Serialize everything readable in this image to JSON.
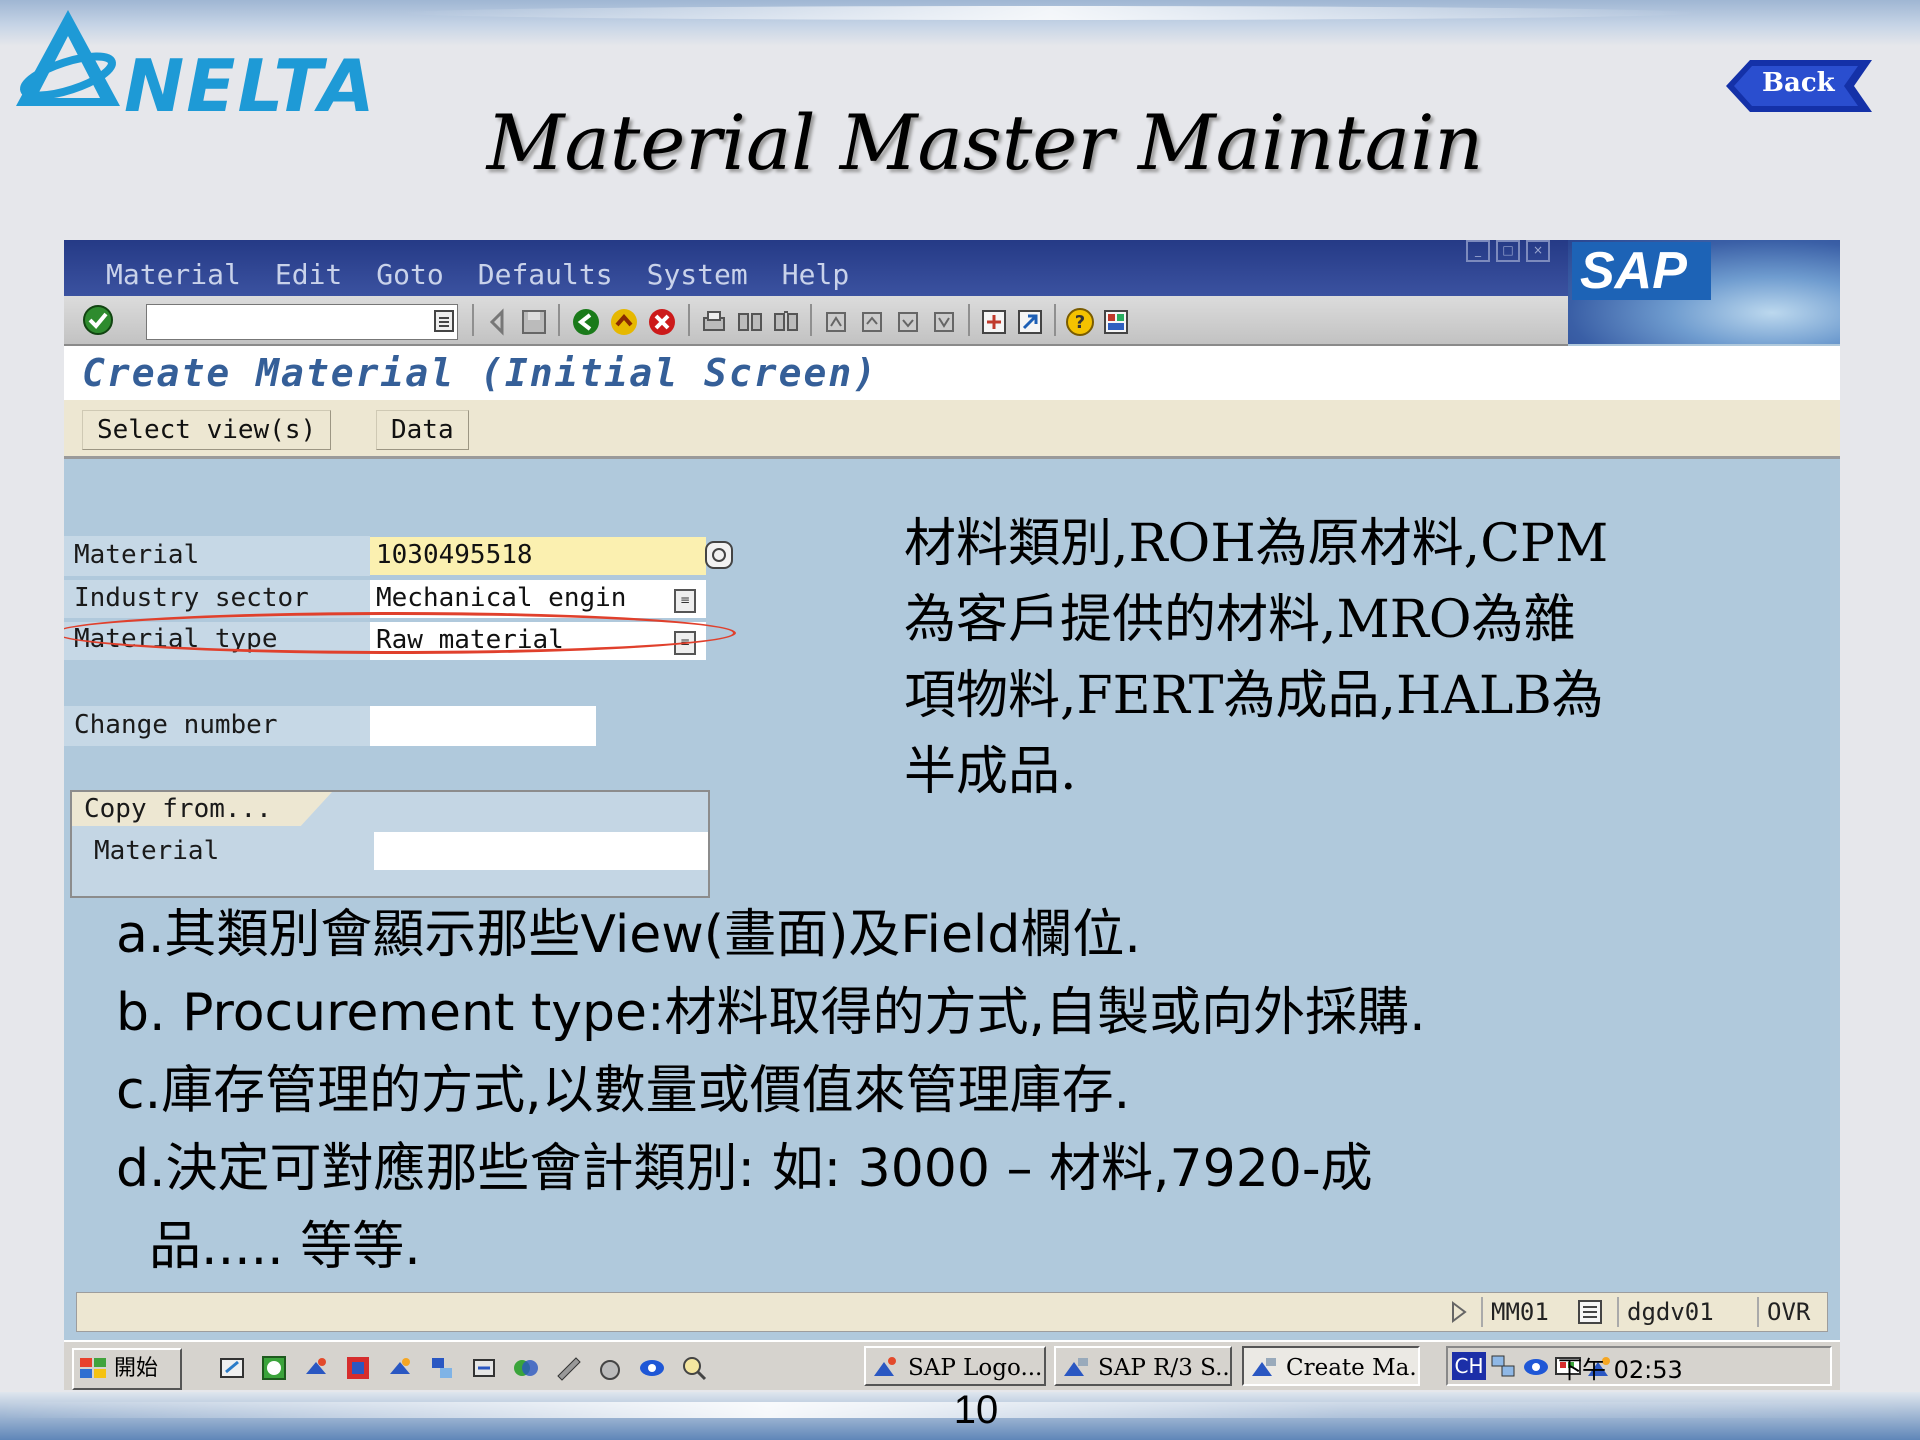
{
  "slide": {
    "logo_text": "NELTA",
    "back_label": "Back",
    "title": "Material Master Maintain",
    "page_number": "10"
  },
  "sap": {
    "menu": [
      "Material",
      "Edit",
      "Goto",
      "Defaults",
      "System",
      "Help"
    ],
    "brand": "SAP",
    "screen_title": "Create Material (Initial Screen)",
    "app_buttons": [
      "Select view(s)",
      "Data"
    ],
    "fields": {
      "material_label": "Material",
      "material_value": "1030495518",
      "industry_label": "Industry sector",
      "industry_value": "Mechanical engin",
      "type_label": "Material type",
      "type_value": "Raw material",
      "change_label": "Change number",
      "change_value": ""
    },
    "copy_from": {
      "title": "Copy from...",
      "material_label": "Material",
      "material_value": ""
    },
    "status": {
      "tcode": "MM01",
      "server": "dgdv01",
      "mode": "OVR"
    }
  },
  "annotation": {
    "note_lines": [
      "材料類別,ROH為原材料,CPM",
      "為客戶提供的材料,MRO為雜",
      "項物料,FERT為成品,HALB為",
      "半成品."
    ],
    "list_lines": [
      "a.其類別會顯示那些View(畫面)及Field欄位.",
      "b. Procurement type:材料取得的方式,自製或向外採購.",
      "c.庫存管理的方式,以數量或價值來管理庫存.",
      "d.決定可對應那些會計類別: 如: 3000 – 材料,7920-成",
      "  品..... 等等."
    ]
  },
  "taskbar": {
    "start_label": "開始",
    "tasks": [
      "SAP Logo...",
      "SAP R/3 S...",
      "Create Ma..."
    ],
    "tray_lang": "CH",
    "clock": "下午 02:53"
  },
  "colors": {
    "sap_background": "#b0c9dc",
    "title_bar": "#253a86",
    "screen_title": "#355f98",
    "required_field": "#fbf0b0",
    "highlight_ellipse": "#e0402c",
    "logo": "#1e9ad6"
  }
}
